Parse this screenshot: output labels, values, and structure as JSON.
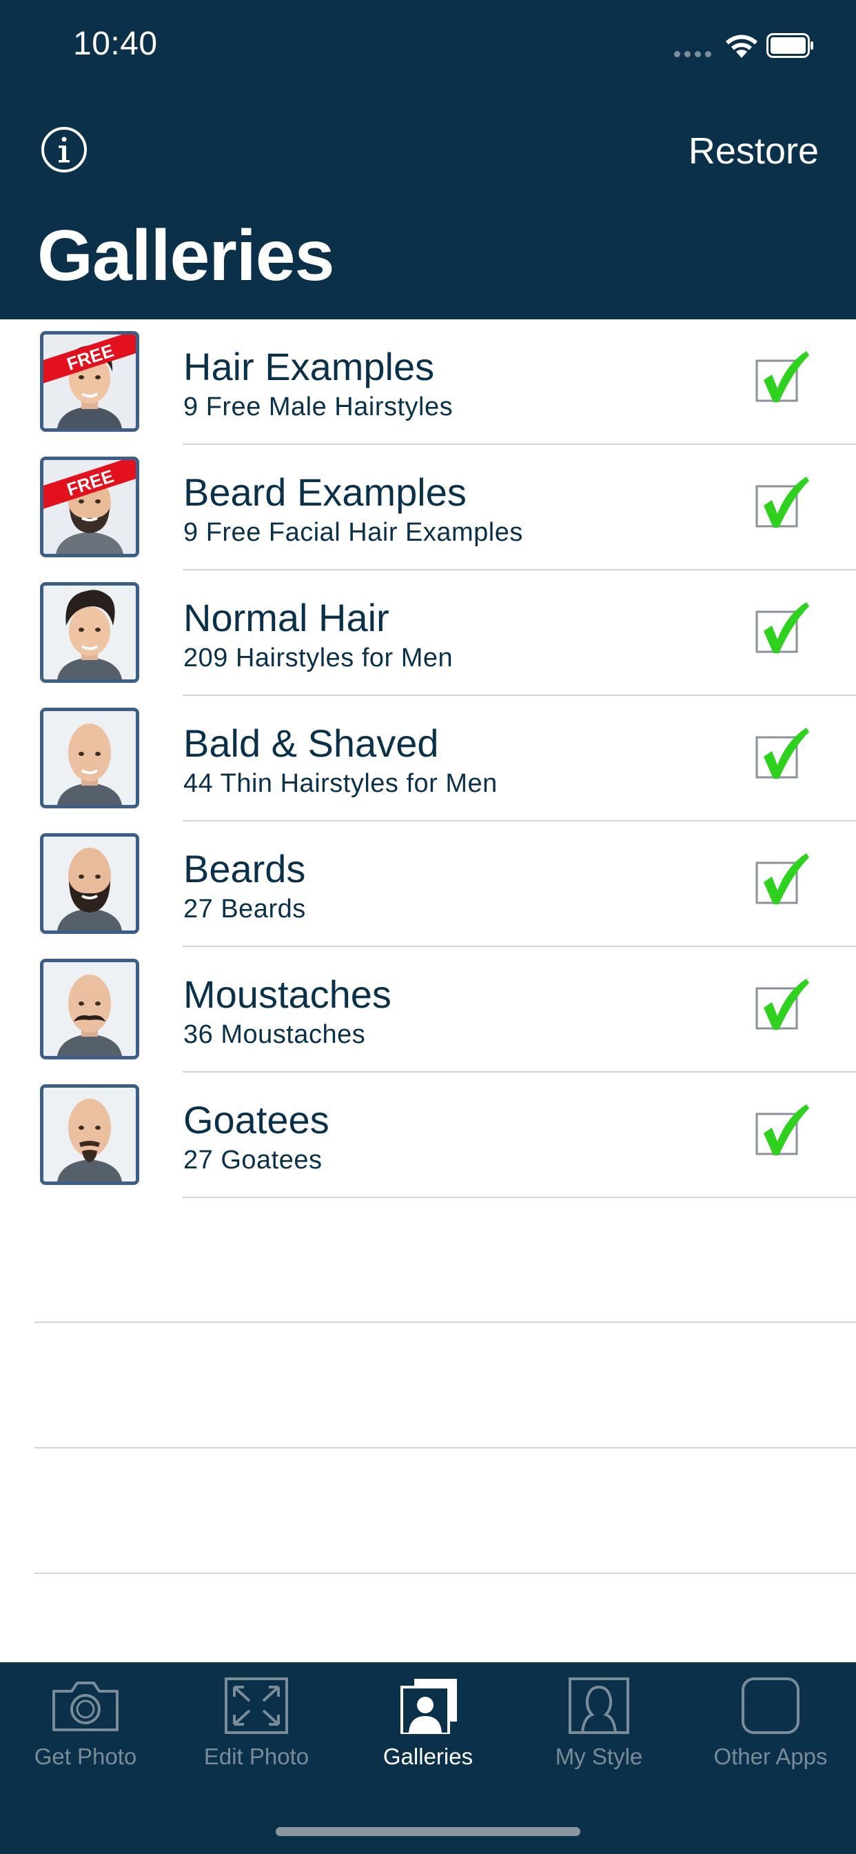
{
  "status_bar": {
    "time": "10:40"
  },
  "header": {
    "restore_label": "Restore",
    "title": "Galleries",
    "info_icon": "info-icon"
  },
  "galleries": [
    {
      "title": "Hair Examples",
      "subtitle": "9 Free Male Hairstyles",
      "badge": "FREE",
      "checked": true
    },
    {
      "title": "Beard Examples",
      "subtitle": "9 Free Facial Hair Examples",
      "badge": "FREE",
      "checked": true
    },
    {
      "title": "Normal Hair",
      "subtitle": "209 Hairstyles for Men",
      "checked": true
    },
    {
      "title": "Bald & Shaved",
      "subtitle": "44 Thin Hairstyles for Men",
      "checked": true
    },
    {
      "title": "Beards",
      "subtitle": "27 Beards",
      "checked": true
    },
    {
      "title": "Moustaches",
      "subtitle": "36 Moustaches",
      "checked": true
    },
    {
      "title": "Goatees",
      "subtitle": "27 Goatees",
      "checked": true
    }
  ],
  "tabs": [
    {
      "label": "Get Photo",
      "icon": "camera-icon",
      "active": false
    },
    {
      "label": "Edit Photo",
      "icon": "resize-icon",
      "active": false
    },
    {
      "label": "Galleries",
      "icon": "gallery-icon",
      "active": true
    },
    {
      "label": "My Style",
      "icon": "person-icon",
      "active": false
    },
    {
      "label": "Other Apps",
      "icon": "apps-icon",
      "active": false
    }
  ],
  "colors": {
    "header_bg": "#0b3049",
    "text": "#0b3049",
    "check_green": "#2fd11f",
    "badge_red": "#e3101d",
    "thumb_border": "#3d5f87"
  }
}
